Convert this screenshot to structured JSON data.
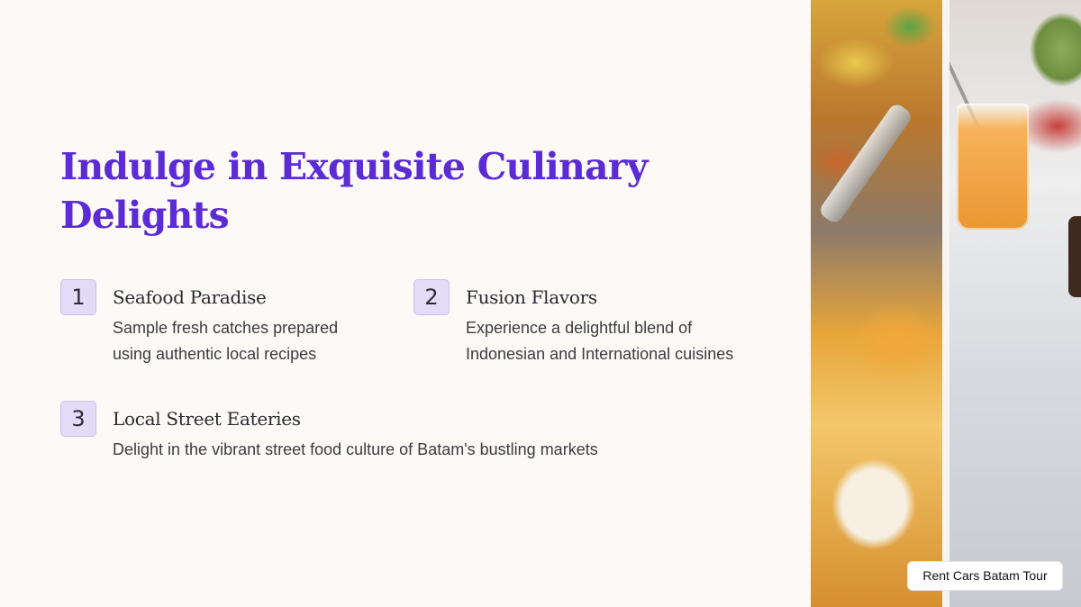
{
  "slide": {
    "title": "Indulge in Exquisite Culinary Delights",
    "items": [
      {
        "number": "1",
        "title": "Seafood Paradise",
        "description": "Sample fresh catches prepared using authentic local recipes"
      },
      {
        "number": "2",
        "title": "Fusion Flavors",
        "description": "Experience a delightful blend of Indonesian and International cuisines"
      },
      {
        "number": "3",
        "title": "Local Street Eateries",
        "description": "Delight in the vibrant street food culture of Batam's bustling markets"
      }
    ]
  },
  "badge": {
    "label": "Rent Cars Batam Tour"
  },
  "colors": {
    "title": "#5b2bd6",
    "number_box": "#e3dcf7",
    "background": "#fcf9f6"
  }
}
